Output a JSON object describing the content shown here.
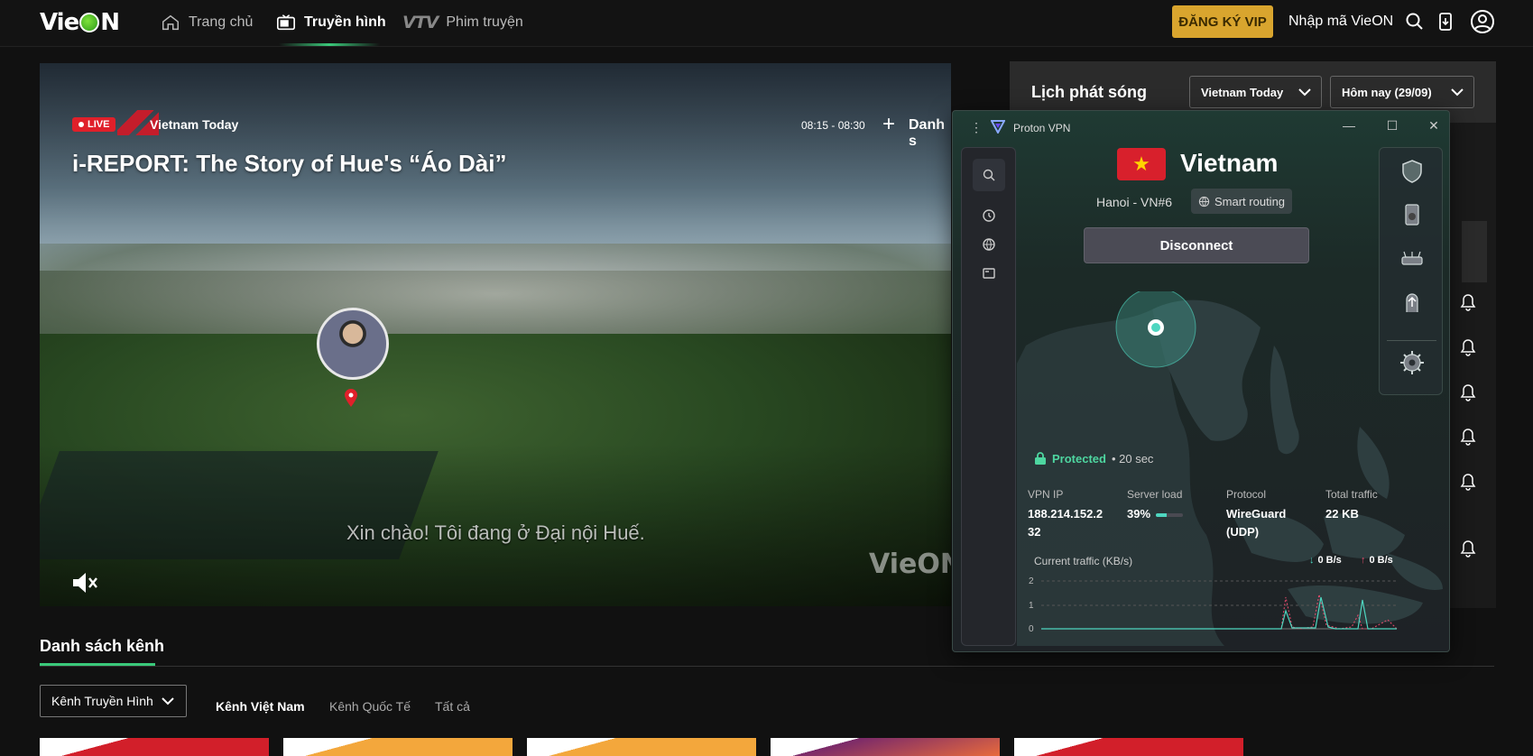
{
  "header": {
    "logo": "VieON",
    "nav": [
      {
        "label": "Trang chủ",
        "icon": "home-icon"
      },
      {
        "label": "Truyền hình",
        "icon": "tv-icon"
      },
      {
        "label": "Phim truyện",
        "icon": "vtv-icon"
      }
    ],
    "vtv_badge": "VTV",
    "vip_button": "ĐĂNG KÝ VIP",
    "code_link": "Nhập mã VieON"
  },
  "player": {
    "live_label": "LIVE",
    "channel": "Vietnam Today",
    "title": "i-REPORT: The Story of Hue's “Áo Dài”",
    "time_range": "08:15 - 08:30",
    "list_label": "Danh s",
    "subtitle": "Xin chào! Tôi đang ở Đại nội Huế.",
    "watermark": "VieON"
  },
  "schedule": {
    "title": "Lịch phát sóng",
    "channel_select": "Vietnam Today",
    "date_select": "Hôm nay (29/09)"
  },
  "channels": {
    "title": "Danh sách kênh",
    "dropdown": "Kênh Truyền Hình",
    "tabs": [
      "Kênh Việt Nam",
      "Kênh Quốc Tế",
      "Tất cả"
    ]
  },
  "vpn": {
    "app_name": "Proton VPN",
    "country": "Vietnam",
    "server": "Hanoi - VN#6",
    "routing": "Smart routing",
    "disconnect": "Disconnect",
    "status": "Protected",
    "duration": "• 20 sec",
    "stats": [
      {
        "key": "VPN IP",
        "value": "188.214.152.2\n32"
      },
      {
        "key": "Server load",
        "value": "39%"
      },
      {
        "key": "Protocol",
        "value": "WireGuard\n(UDP)"
      },
      {
        "key": "Total traffic",
        "value": "22 KB"
      }
    ],
    "server_load": 0.39,
    "traffic_title": "Current traffic (KB/s)",
    "download_rate": "0 B/s",
    "upload_rate": "0 B/s",
    "graph_ticks": [
      "2",
      "1",
      "0"
    ],
    "accent": "#4ed6c0"
  }
}
